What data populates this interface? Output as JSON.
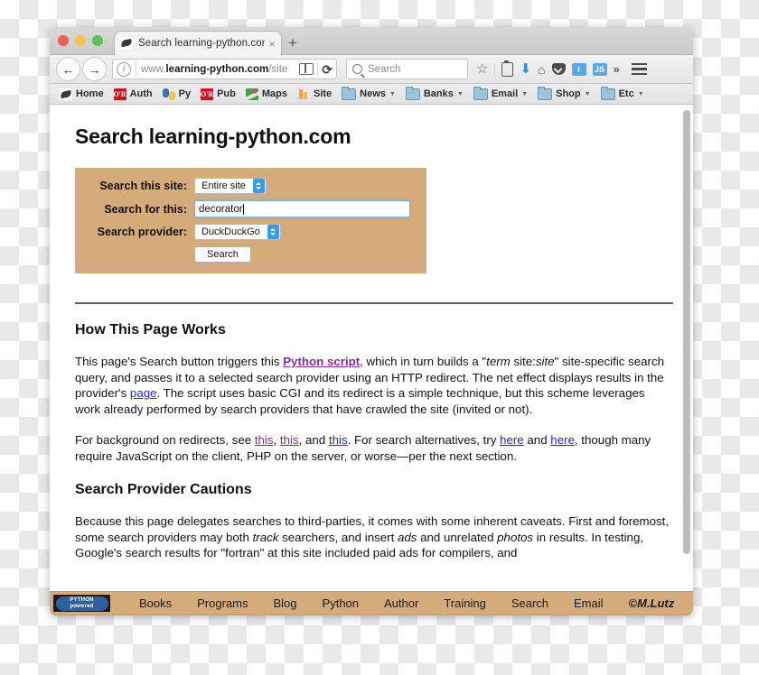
{
  "window": {
    "traffic_lights": [
      "close",
      "minimize",
      "maximize"
    ],
    "tab": {
      "title": "Search learning-python.com",
      "close_label": "×",
      "favicon": "python-snake-icon"
    },
    "new_tab_label": "+"
  },
  "toolbar": {
    "back_label": "←",
    "forward_label": "→",
    "url": {
      "prefix": "www.",
      "domain": "learning-python.com",
      "path": "/site",
      "info_label": "i"
    },
    "reader_icon": "reader-view-icon",
    "reload_label": "⟳",
    "search": {
      "placeholder": "Search",
      "icon": "magnifier-icon"
    },
    "icons": [
      {
        "name": "bookmark-star-icon",
        "glyph": "☆"
      },
      {
        "name": "clipboard-icon",
        "glyph": ""
      },
      {
        "name": "download-arrow-icon",
        "glyph": "⬇"
      },
      {
        "name": "home-icon",
        "glyph": "⌂"
      },
      {
        "name": "pocket-icon",
        "glyph": ""
      },
      {
        "name": "identity-badge-icon",
        "glyph": "I"
      },
      {
        "name": "javascript-badge-icon",
        "glyph": "JS"
      },
      {
        "name": "overflow-chevrons-icon",
        "glyph": "»"
      }
    ],
    "menu_label": "☰"
  },
  "bookmarks": [
    {
      "label": "Home",
      "icon": "snake-icon",
      "has_arrow": false
    },
    {
      "label": "Auth",
      "icon": "oreilly-icon",
      "icon_text": "O'R",
      "has_arrow": false
    },
    {
      "label": "Py",
      "icon": "python-icon",
      "has_arrow": false
    },
    {
      "label": "Pub",
      "icon": "oreilly-icon",
      "icon_text": "O'R",
      "has_arrow": false
    },
    {
      "label": "Maps",
      "icon": "google-maps-icon",
      "has_arrow": false
    },
    {
      "label": "Site",
      "icon": "analytics-icon",
      "has_arrow": false
    },
    {
      "label": "News",
      "icon": "folder-icon",
      "has_arrow": true
    },
    {
      "label": "Banks",
      "icon": "folder-icon",
      "has_arrow": true
    },
    {
      "label": "Email",
      "icon": "folder-icon",
      "has_arrow": true
    },
    {
      "label": "Shop",
      "icon": "folder-icon",
      "has_arrow": true
    },
    {
      "label": "Etc",
      "icon": "folder-icon",
      "has_arrow": true
    }
  ],
  "page": {
    "title": "Search learning-python.com",
    "form": {
      "site_label": "Search this site:",
      "site_value": "Entire site",
      "query_label": "Search for this:",
      "query_value": "decorator",
      "provider_label": "Search provider:",
      "provider_value": "DuckDuckGo",
      "submit_label": "Search"
    },
    "section1": {
      "heading": "How This Page Works",
      "p1": {
        "t1": "This page's Search button triggers this ",
        "link1": "Python script",
        "t2": ", which in turn builds a \"",
        "em1": "term",
        "t3": " site:",
        "em2": "site",
        "t4": "\" site-specific search query, and passes it to a selected search provider using an HTTP redirect. The net effect displays results in the provider's ",
        "link2": "page",
        "t5": ". The script uses basic CGI and its redirect is a simple technique, but this scheme leverages work already performed by search providers that have crawled the site (invited or not)."
      },
      "p2": {
        "t1": "For background on redirects, see ",
        "link1": "this",
        "t2": ", ",
        "link2": "this",
        "t3": ", and ",
        "link3": "this",
        "t4": ". For search alternatives, try ",
        "link4": "here",
        "t5": " and ",
        "link5": "here",
        "t6": ", though many require JavaScript on the client, PHP on the server, or worse—per the next section."
      }
    },
    "section2": {
      "heading": "Search Provider Cautions",
      "p1": {
        "t1": "Because this page delegates searches to third-parties, it comes with some inherent caveats. First and foremost, some search providers may both ",
        "em1": "track",
        "t2": " searchers, and insert ",
        "em2": "ads",
        "t3": " and unrelated ",
        "em3": "photos",
        "t4": " in results. In testing, Google's search results for \"fortran\" at this site included paid ads for compilers, and"
      }
    }
  },
  "footer": {
    "badge_line1": "PYTHON",
    "badge_line2": "powered",
    "links": [
      "Books",
      "Programs",
      "Blog",
      "Python",
      "Author",
      "Training",
      "Search",
      "Email"
    ],
    "copyright": "©M.Lutz"
  },
  "colors": {
    "panel_tan": "#d5ab79",
    "link_blue": "#2424d8",
    "link_visited": "#7b2f9e",
    "stepper_blue": "#3d9ae8",
    "badge_blue": "#5aa7e8"
  }
}
